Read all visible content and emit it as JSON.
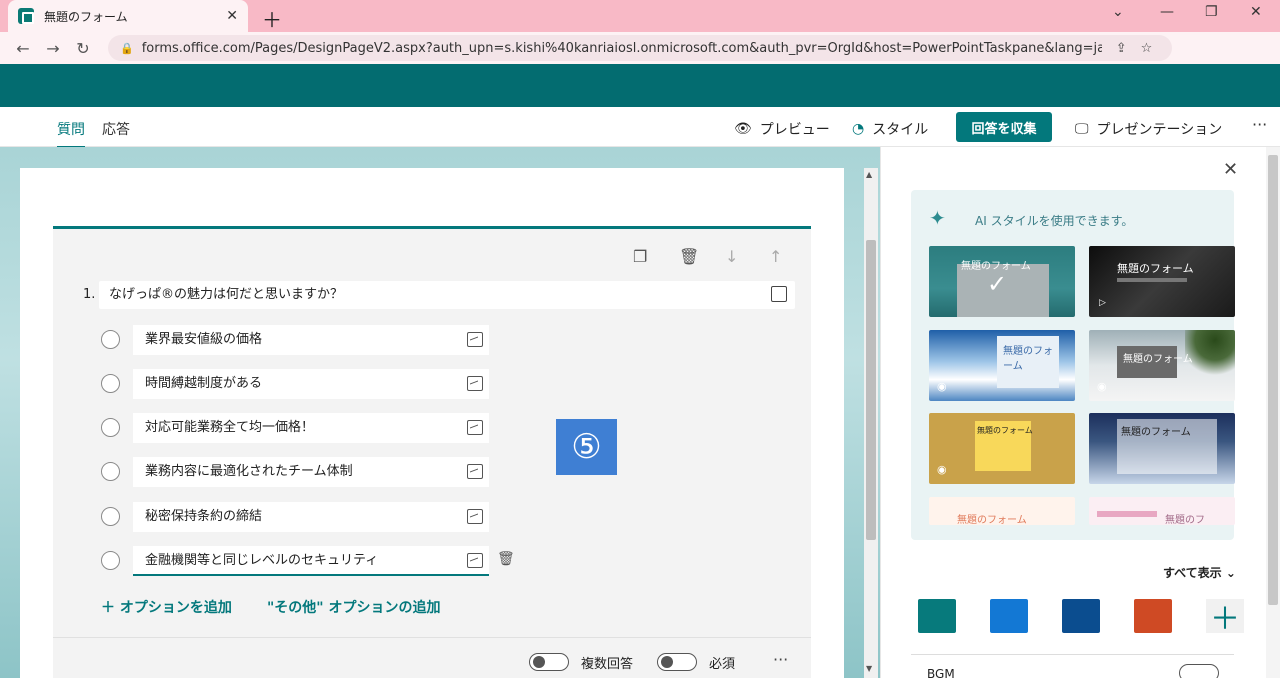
{
  "browser": {
    "tab_title": "無題のフォーム",
    "url": "forms.office.com/Pages/DesignPageV2.aspx?auth_upn=s.kishi%40kanriaiosl.onmicrosoft.com&auth_pvr=OrgId&host=PowerPointTaskpane&lang=ja-jp&i..."
  },
  "header": {
    "tabs": [
      {
        "label": "質問",
        "active": true
      },
      {
        "label": "応答",
        "active": false
      }
    ],
    "preview_label": "プレビュー",
    "style_label": "スタイル",
    "collect_label": "回答を収集",
    "present_label": "プレゼンテーション"
  },
  "question": {
    "number": "1.",
    "title": "なげっぱ®の魅力は何だと思いますか？",
    "options": [
      "業界最安値級の価格",
      "時間縛越制度がある",
      "対応可能業務全て均一価格！",
      "業務内容に最適化されたチーム体制",
      "秘密保持条約の締結",
      "金融機関等と同じレベルのセキュリティ"
    ],
    "add_option_label": "オプションを追加",
    "add_other_label": "\"その他\" オプションの追加",
    "multi_answer_label": "複数回答",
    "required_label": "必須"
  },
  "badge": "⑤",
  "style_panel": {
    "ai_text": "AI スタイルを使用できます。",
    "themes": [
      {
        "title": "無題のフォーム",
        "selected": true
      },
      {
        "title": "無題のフォーム"
      },
      {
        "title": "無題のフォーム"
      },
      {
        "title": "無題のフォーム"
      },
      {
        "title": "無題のフォーム"
      },
      {
        "title": "無題のフォーム"
      },
      {
        "title": "無題のフォーム"
      },
      {
        "title": "無題のフ"
      }
    ],
    "show_all_label": "すべて表示",
    "swatches": [
      "#077a7c",
      "#1378d4",
      "#0b4d8f",
      "#cf4a24"
    ],
    "bgm_label": "BGM"
  }
}
